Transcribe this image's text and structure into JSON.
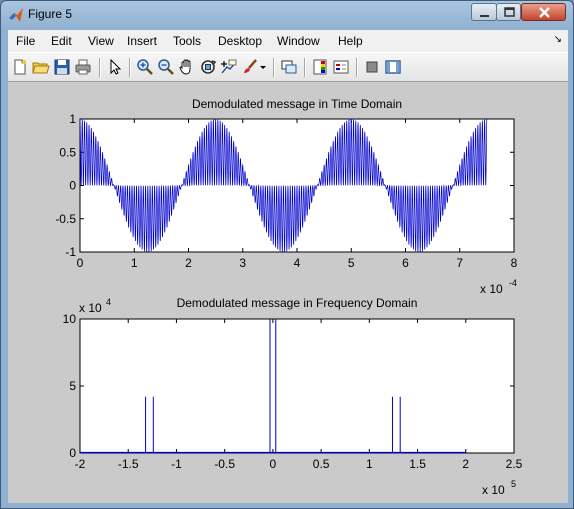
{
  "window": {
    "title": "Figure 5"
  },
  "menu": {
    "items": [
      "File",
      "Edit",
      "View",
      "Insert",
      "Tools",
      "Desktop",
      "Window",
      "Help"
    ],
    "overflow_arrow": "↘"
  },
  "toolbar": {
    "icons": [
      "new-figure-icon",
      "open-file-icon",
      "save-icon",
      "print-icon",
      "select-arrow-icon",
      "zoom-in-icon",
      "zoom-out-icon",
      "pan-hand-icon",
      "rotate-3d-icon",
      "data-cursor-icon",
      "brush-icon",
      "link-plot-icon",
      "colorbar-icon",
      "legend-icon",
      "hide-plot-tools-icon",
      "show-plot-tools-icon"
    ]
  },
  "colors": {
    "plot_line": "#0000cc",
    "figure_bg": "#cacaca",
    "axes_bg": "#ffffff"
  },
  "chart_data": [
    {
      "type": "line",
      "title": "Demodulated message in Time Domain",
      "xlim": [
        0,
        8
      ],
      "ylim": [
        -1,
        1
      ],
      "xticks": [
        "0",
        "1",
        "2",
        "3",
        "4",
        "5",
        "6",
        "7",
        "8"
      ],
      "yticks": [
        "-1",
        "-0.5",
        "0",
        "0.5",
        "1"
      ],
      "x_multiplier": {
        "base": "x 10",
        "exponent": "-4"
      },
      "series": [
        {
          "x_range": [
            0,
            7.5
          ],
          "description_values": {
            "message_period": 2.5,
            "envelope_peaks": [
              0,
              2.5,
              5,
              7.5
            ],
            "envelope_troughs": [
              1.25,
              3.75,
              6.25
            ]
          }
        }
      ],
      "grid": false
    },
    {
      "type": "line",
      "title": "Demodulated message in Frequency Domain",
      "xlim": [
        -2,
        2.5
      ],
      "ylim": [
        0,
        10
      ],
      "xticks": [
        "-2",
        "-1.5",
        "-1",
        "-0.5",
        "0",
        "0.5",
        "1",
        "1.5",
        "2",
        "2.5"
      ],
      "yticks": [
        "0",
        "5",
        "10"
      ],
      "x_multiplier": {
        "base": "x 10",
        "exponent": "5"
      },
      "y_multiplier": {
        "base": "x 10",
        "exponent": "4"
      },
      "series": [
        {
          "x_range": [
            -2,
            2
          ],
          "spikes": [
            {
              "x": -1.32,
              "y": 4.2
            },
            {
              "x": -1.24,
              "y": 4.2
            },
            {
              "x": -0.03,
              "y": 10
            },
            {
              "x": 0.03,
              "y": 10
            },
            {
              "x": 1.24,
              "y": 4.2
            },
            {
              "x": 1.32,
              "y": 4.2
            }
          ]
        }
      ],
      "grid": false
    }
  ]
}
